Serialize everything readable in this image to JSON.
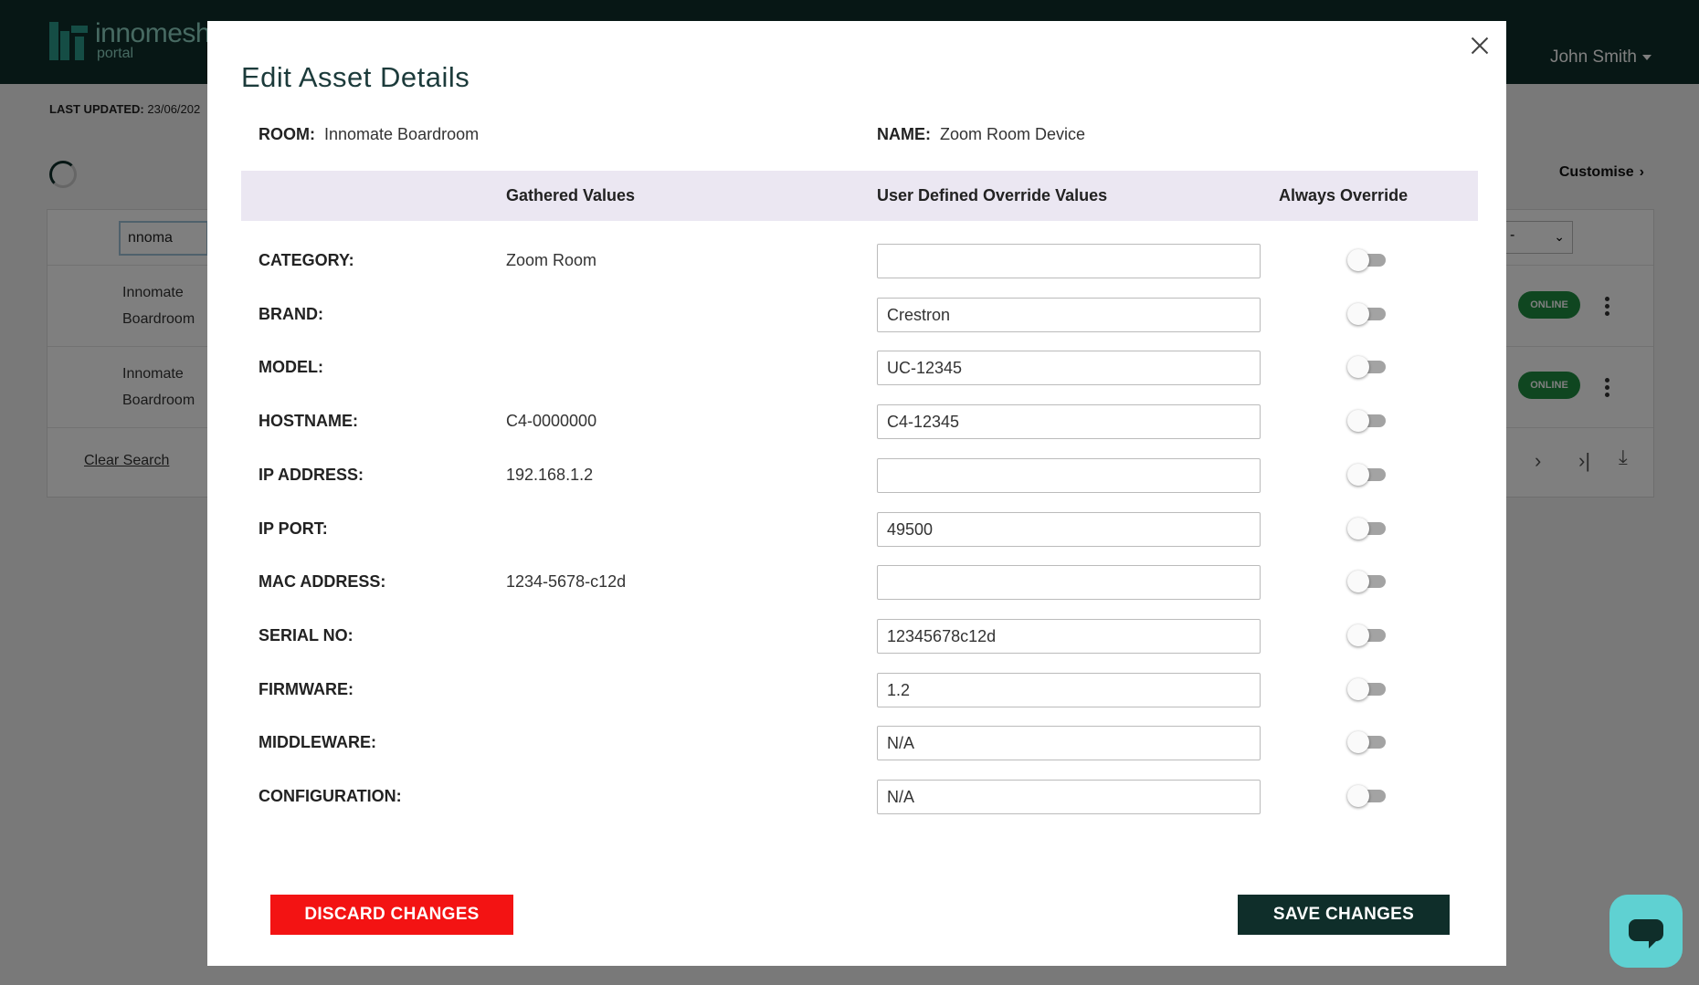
{
  "app": {
    "logo_word": "innomesh",
    "logo_sub": "portal",
    "user_name": "John Smith",
    "last_updated_label": "LAST UPDATED:",
    "last_updated_value": "23/06/202",
    "customise_label": "Customise",
    "search_value": "nnoma",
    "clear_search_label": "Clear Search",
    "rows": [
      {
        "room_line1": "Innomate",
        "room_line2": "Boardroom",
        "status": "ONLINE"
      },
      {
        "room_line1": "Innomate",
        "room_line2": "Boardroom",
        "status": "ONLINE"
      }
    ],
    "select_value": "-"
  },
  "modal": {
    "title": "Edit Asset Details",
    "room_label": "ROOM:",
    "room_value": "Innomate Boardroom",
    "name_label": "NAME:",
    "name_value": "Zoom Room Device",
    "columns": {
      "gathered": "Gathered Values",
      "override": "User Defined Override Values",
      "always": "Always Override"
    },
    "fields": [
      {
        "label": "CATEGORY:",
        "gathered": "Zoom Room",
        "override": "",
        "always": false
      },
      {
        "label": "BRAND:",
        "gathered": "",
        "override": "Crestron",
        "always": false
      },
      {
        "label": "MODEL:",
        "gathered": "",
        "override": "UC-12345",
        "always": false
      },
      {
        "label": "HOSTNAME:",
        "gathered": "C4-0000000",
        "override": "C4-12345",
        "always": false
      },
      {
        "label": "IP ADDRESS:",
        "gathered": "192.168.1.2",
        "override": "",
        "always": false
      },
      {
        "label": "IP PORT:",
        "gathered": "",
        "override": "49500",
        "always": false
      },
      {
        "label": "MAC ADDRESS:",
        "gathered": "1234-5678-c12d",
        "override": "",
        "always": false
      },
      {
        "label": "SERIAL NO:",
        "gathered": "",
        "override": "12345678c12d",
        "always": false
      },
      {
        "label": "FIRMWARE:",
        "gathered": "",
        "override": "1.2",
        "always": false
      },
      {
        "label": "MIDDLEWARE:",
        "gathered": "",
        "override": "N/A",
        "always": false
      },
      {
        "label": "CONFIGURATION:",
        "gathered": "",
        "override": "N/A",
        "always": false
      }
    ],
    "discard_label": "DISCARD CHANGES",
    "save_label": "SAVE CHANGES"
  },
  "colors": {
    "brand_dark": "#0f2e2a",
    "discard_red": "#f31313",
    "online_green": "#1e8c40",
    "header_row": "#ebe7f2",
    "chat_button": "#5fd1d2"
  },
  "icons": {
    "close": "close-icon",
    "chat": "chat-icon",
    "kebab": "kebab-menu-icon",
    "download": "download-icon"
  }
}
